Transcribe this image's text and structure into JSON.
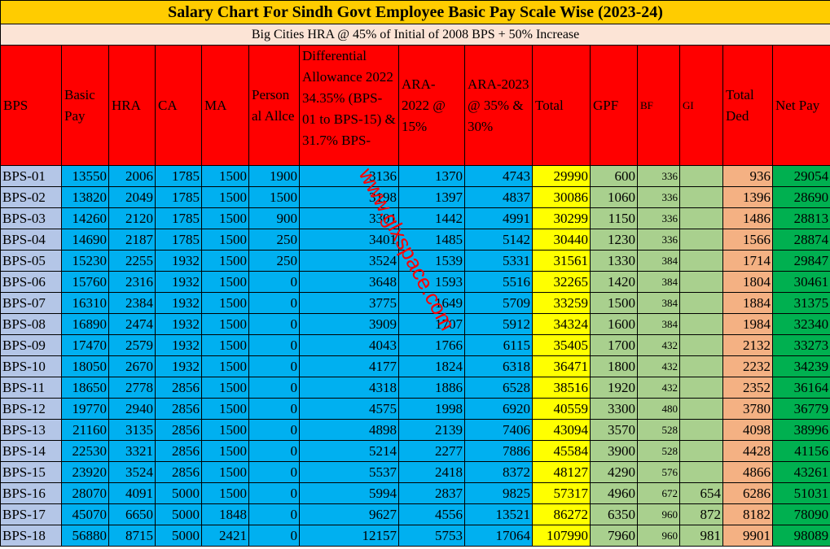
{
  "title": "Salary Chart For Sindh Govt Employee Basic Pay Scale Wise (2023-24)",
  "subtitle": "Big Cities HRA @ 45% of Initial of 2008 BPS + 50% Increase",
  "watermark": "www.glxspace.com",
  "colors": {
    "title_bg": "#ffcc00",
    "header_bg": "#ff0000",
    "bps_col": "#b4c6e7",
    "allowance_cols": "#00b0f0",
    "total_col": "#ffff00",
    "deduction_cols": "#a9d08e",
    "total_ded_col": "#f4b183",
    "net_pay_col": "#00b050"
  },
  "table": {
    "headers": [
      "BPS",
      "Basic Pay",
      "HRA",
      "CA",
      "MA",
      "Person al Allce",
      "Differential Allowance 2022 34.35% (BPS-01 to BPS-15) & 31.7% BPS-",
      "ARA-2022 @ 15%",
      "ARA-2023 @ 35% & 30%",
      "Total",
      "GPF",
      "BF",
      "GI",
      "Total Ded",
      "Net Pay"
    ],
    "rows": [
      [
        "BPS-01",
        "13550",
        "2006",
        "1785",
        "1500",
        "1900",
        "3136",
        "1370",
        "4743",
        "29990",
        "600",
        "336",
        "",
        "936",
        "29054"
      ],
      [
        "BPS-02",
        "13820",
        "2049",
        "1785",
        "1500",
        "1500",
        "3198",
        "1397",
        "4837",
        "30086",
        "1060",
        "336",
        "",
        "1396",
        "28690"
      ],
      [
        "BPS-03",
        "14260",
        "2120",
        "1785",
        "1500",
        "900",
        "3301",
        "1442",
        "4991",
        "30299",
        "1150",
        "336",
        "",
        "1486",
        "28813"
      ],
      [
        "BPS-04",
        "14690",
        "2187",
        "1785",
        "1500",
        "250",
        "3401",
        "1485",
        "5142",
        "30440",
        "1230",
        "336",
        "",
        "1566",
        "28874"
      ],
      [
        "BPS-05",
        "15230",
        "2255",
        "1932",
        "1500",
        "250",
        "3524",
        "1539",
        "5331",
        "31561",
        "1330",
        "384",
        "",
        "1714",
        "29847"
      ],
      [
        "BPS-06",
        "15760",
        "2316",
        "1932",
        "1500",
        "0",
        "3648",
        "1593",
        "5516",
        "32265",
        "1420",
        "384",
        "",
        "1804",
        "30461"
      ],
      [
        "BPS-07",
        "16310",
        "2384",
        "1932",
        "1500",
        "0",
        "3775",
        "1649",
        "5709",
        "33259",
        "1500",
        "384",
        "",
        "1884",
        "31375"
      ],
      [
        "BPS-08",
        "16890",
        "2474",
        "1932",
        "1500",
        "0",
        "3909",
        "1707",
        "5912",
        "34324",
        "1600",
        "384",
        "",
        "1984",
        "32340"
      ],
      [
        "BPS-09",
        "17470",
        "2579",
        "1932",
        "1500",
        "0",
        "4043",
        "1766",
        "6115",
        "35405",
        "1700",
        "432",
        "",
        "2132",
        "33273"
      ],
      [
        "BPS-10",
        "18050",
        "2670",
        "1932",
        "1500",
        "0",
        "4177",
        "1824",
        "6318",
        "36471",
        "1800",
        "432",
        "",
        "2232",
        "34239"
      ],
      [
        "BPS-11",
        "18650",
        "2778",
        "2856",
        "1500",
        "0",
        "4318",
        "1886",
        "6528",
        "38516",
        "1920",
        "432",
        "",
        "2352",
        "36164"
      ],
      [
        "BPS-12",
        "19770",
        "2940",
        "2856",
        "1500",
        "0",
        "4575",
        "1998",
        "6920",
        "40559",
        "3300",
        "480",
        "",
        "3780",
        "36779"
      ],
      [
        "BPS-13",
        "21160",
        "3135",
        "2856",
        "1500",
        "0",
        "4898",
        "2139",
        "7406",
        "43094",
        "3570",
        "528",
        "",
        "4098",
        "38996"
      ],
      [
        "BPS-14",
        "22530",
        "3321",
        "2856",
        "1500",
        "0",
        "5214",
        "2277",
        "7886",
        "45584",
        "3900",
        "528",
        "",
        "4428",
        "41156"
      ],
      [
        "BPS-15",
        "23920",
        "3524",
        "2856",
        "1500",
        "0",
        "5537",
        "2418",
        "8372",
        "48127",
        "4290",
        "576",
        "",
        "4866",
        "43261"
      ],
      [
        "BPS-16",
        "28070",
        "4091",
        "5000",
        "1500",
        "0",
        "5994",
        "2837",
        "9825",
        "57317",
        "4960",
        "672",
        "654",
        "6286",
        "51031"
      ],
      [
        "BPS-17",
        "45070",
        "6650",
        "5000",
        "1848",
        "0",
        "9627",
        "4556",
        "13521",
        "86272",
        "6350",
        "960",
        "872",
        "8182",
        "78090"
      ],
      [
        "BPS-18",
        "56880",
        "8715",
        "5000",
        "2421",
        "0",
        "12157",
        "5753",
        "17064",
        "107990",
        "7960",
        "960",
        "981",
        "9901",
        "98089"
      ]
    ]
  }
}
